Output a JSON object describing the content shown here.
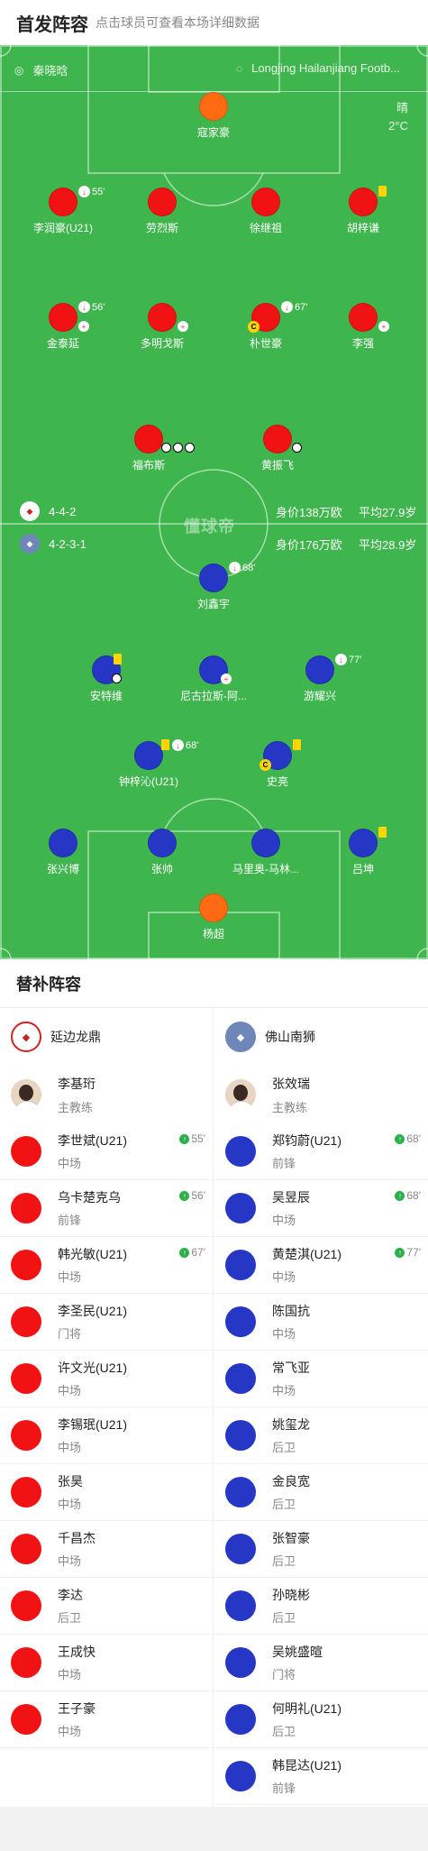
{
  "header": {
    "title": "首发阵容",
    "hint": "点击球员可查看本场详细数据"
  },
  "match": {
    "referee": "秦晓晗",
    "venue": "Longjing Hailanjiang Footb...",
    "weather": "晴",
    "temperature": "2°C"
  },
  "watermark": "懂球帝",
  "home": {
    "formation": "4-4-2",
    "worth": "身价138万欧",
    "age": "平均27.9岁",
    "players": [
      {
        "name": "寇家豪",
        "color": "orange"
      },
      {
        "name": "李润豪(U21)",
        "color": "red",
        "sub_min": "55'"
      },
      {
        "name": "劳烈斯",
        "color": "red"
      },
      {
        "name": "徐继祖",
        "color": "red"
      },
      {
        "name": "胡梓谦",
        "color": "red",
        "yellow": true
      },
      {
        "name": "金泰延",
        "color": "red",
        "sub_min": "56'"
      },
      {
        "name": "多明戈斯",
        "color": "red"
      },
      {
        "name": "朴世豪",
        "color": "red",
        "sub_min": "67'",
        "captain": "C"
      },
      {
        "name": "李强",
        "color": "red"
      },
      {
        "name": "福布斯",
        "color": "red",
        "goals": 3
      },
      {
        "name": "黄振飞",
        "color": "red",
        "goals": 1
      }
    ]
  },
  "away": {
    "formation": "4-2-3-1",
    "worth": "身价176万欧",
    "age": "平均28.9岁",
    "players": [
      {
        "name": "刘鑫宇",
        "color": "blue",
        "sub_min": "68'"
      },
      {
        "name": "安特维",
        "color": "blue",
        "yellow": true
      },
      {
        "name": "尼古拉斯-阿...",
        "color": "blue"
      },
      {
        "name": "游耀兴",
        "color": "blue",
        "sub_min": "77'"
      },
      {
        "name": "钟梓沁(U21)",
        "color": "blue",
        "sub_min": "68'",
        "yellow": true
      },
      {
        "name": "史亮",
        "color": "blue",
        "yellow": true,
        "captain": "C"
      },
      {
        "name": "张兴博",
        "color": "blue"
      },
      {
        "name": "张帅",
        "color": "blue"
      },
      {
        "name": "马里奥-马林...",
        "color": "blue"
      },
      {
        "name": "吕坤",
        "color": "blue",
        "yellow": true
      },
      {
        "name": "杨超",
        "color": "orange"
      }
    ]
  },
  "subs": {
    "title": "替补阵容",
    "home": {
      "team": "延边龙鼎",
      "coach": "李基珩",
      "coach_role": "主教练",
      "list": [
        {
          "name": "李世斌(U21)",
          "pos": "中场",
          "min": "55'"
        },
        {
          "name": "乌卡楚克乌",
          "pos": "前锋",
          "min": "56'"
        },
        {
          "name": "韩光敏(U21)",
          "pos": "中场",
          "min": "67'"
        },
        {
          "name": "李圣民(U21)",
          "pos": "门将"
        },
        {
          "name": "许文光(U21)",
          "pos": "中场"
        },
        {
          "name": "李锡珉(U21)",
          "pos": "中场"
        },
        {
          "name": "张昊",
          "pos": "中场"
        },
        {
          "name": "千昌杰",
          "pos": "中场"
        },
        {
          "name": "李达",
          "pos": "后卫"
        },
        {
          "name": "王成快",
          "pos": "中场"
        },
        {
          "name": "王子豪",
          "pos": "中场"
        }
      ]
    },
    "away": {
      "team": "佛山南狮",
      "coach": "张效瑞",
      "coach_role": "主教练",
      "list": [
        {
          "name": "郑钧蔚(U21)",
          "pos": "前锋",
          "min": "68'"
        },
        {
          "name": "吴昱辰",
          "pos": "中场",
          "min": "68'"
        },
        {
          "name": "黄楚淇(U21)",
          "pos": "中场",
          "min": "77'"
        },
        {
          "name": "陈国抗",
          "pos": "中场"
        },
        {
          "name": "常飞亚",
          "pos": "中场"
        },
        {
          "name": "姚玺龙",
          "pos": "后卫"
        },
        {
          "name": "金良宽",
          "pos": "后卫"
        },
        {
          "name": "张智豪",
          "pos": "后卫"
        },
        {
          "name": "孙晓彬",
          "pos": "后卫"
        },
        {
          "name": "吴姚盛暄",
          "pos": "门将"
        },
        {
          "name": "何明礼(U21)",
          "pos": "后卫"
        },
        {
          "name": "韩昆达(U21)",
          "pos": "前锋"
        }
      ]
    }
  },
  "colors": {
    "pitch": "#3fb54d",
    "home": "#f11313",
    "away": "#2637c6",
    "keeper": "#ff6a12"
  }
}
